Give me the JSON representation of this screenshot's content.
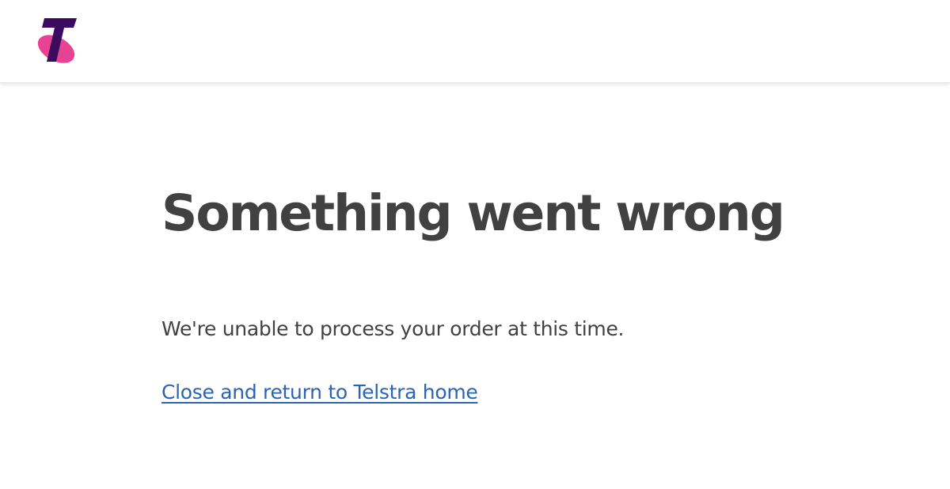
{
  "brand": {
    "logo_icon": "telstra-logo-icon",
    "logo_letter": "T",
    "colors": {
      "magenta": "#e84393",
      "purple": "#3b0b5f"
    }
  },
  "error": {
    "title": "Something went wrong",
    "message": "We're unable to process your order at this time.",
    "link_label": "Close and return to Telstra home"
  },
  "colors": {
    "text": "#414141",
    "link": "#2b63b7",
    "background": "#ffffff"
  }
}
